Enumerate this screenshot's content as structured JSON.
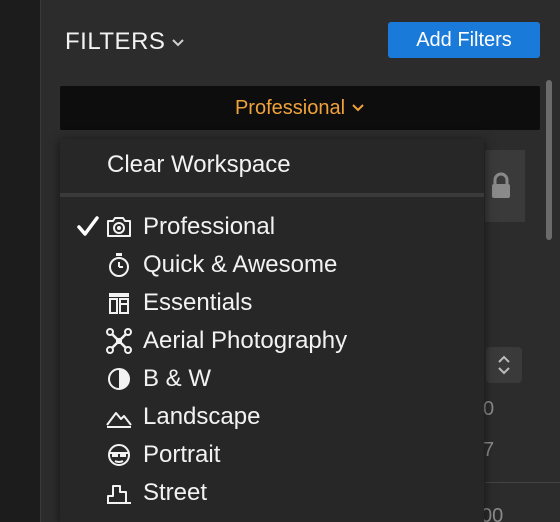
{
  "header": {
    "title": "FILTERS",
    "add_filters_label": "Add Filters"
  },
  "workspace": {
    "selected": "Professional"
  },
  "menu": {
    "clear_label": "Clear Workspace",
    "items": [
      {
        "label": "Professional",
        "icon": "camera-icon",
        "checked": true
      },
      {
        "label": "Quick & Awesome",
        "icon": "stopwatch-icon",
        "checked": false
      },
      {
        "label": "Essentials",
        "icon": "layout-icon",
        "checked": false
      },
      {
        "label": "Aerial Photography",
        "icon": "drone-icon",
        "checked": false
      },
      {
        "label": "B & W",
        "icon": "half-circle-icon",
        "checked": false
      },
      {
        "label": "Landscape",
        "icon": "mountain-icon",
        "checked": false
      },
      {
        "label": "Portrait",
        "icon": "face-icon",
        "checked": false
      },
      {
        "label": "Street",
        "icon": "buildings-icon",
        "checked": false
      }
    ]
  },
  "background": {
    "digits": [
      "0",
      "7",
      "00"
    ]
  },
  "colors": {
    "accent": "#1a7ad9",
    "workspace_text": "#f0a23a",
    "panel": "#2c2c2c",
    "menu": "#272727"
  }
}
